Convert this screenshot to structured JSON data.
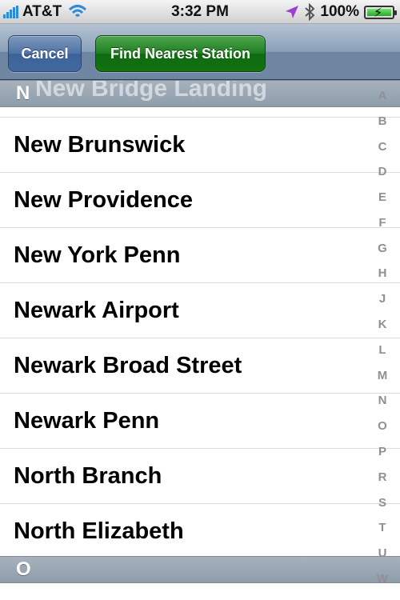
{
  "status_bar": {
    "carrier": "AT&T",
    "time": "3:32 PM",
    "battery": "100%",
    "battery_level": 1.0
  },
  "nav": {
    "cancel_label": "Cancel",
    "find_label": "Find Nearest Station",
    "colors": {
      "cancel": "#4a6fa3",
      "find": "#1b7a1b"
    }
  },
  "sections": {
    "current": "N",
    "next": "O",
    "partial_row": "New Bridge Landing"
  },
  "stations": [
    "New Brunswick",
    "New Providence",
    "New York Penn",
    "Newark Airport",
    "Newark Broad Street",
    "Newark Penn",
    "North Branch",
    "North Elizabeth"
  ],
  "index_letters": [
    "A",
    "B",
    "C",
    "D",
    "E",
    "F",
    "G",
    "H",
    "J",
    "K",
    "L",
    "M",
    "N",
    "O",
    "P",
    "R",
    "S",
    "T",
    "U",
    "W"
  ]
}
